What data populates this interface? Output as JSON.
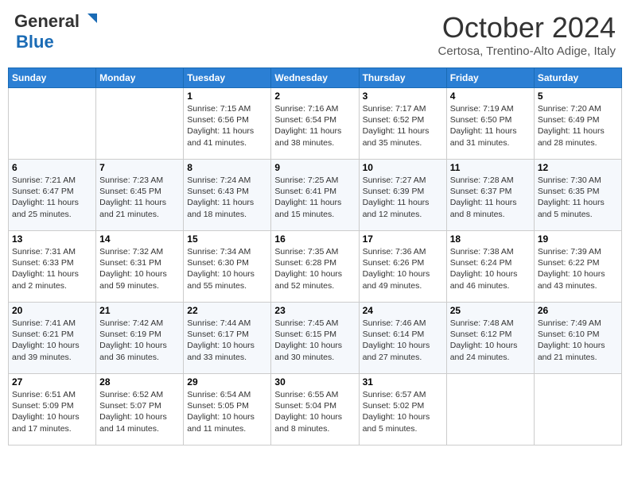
{
  "header": {
    "logo_main": "General",
    "logo_sub": "Blue",
    "month": "October 2024",
    "location": "Certosa, Trentino-Alto Adige, Italy"
  },
  "days_of_week": [
    "Sunday",
    "Monday",
    "Tuesday",
    "Wednesday",
    "Thursday",
    "Friday",
    "Saturday"
  ],
  "weeks": [
    [
      {
        "day": "",
        "sunrise": "",
        "sunset": "",
        "daylight": ""
      },
      {
        "day": "",
        "sunrise": "",
        "sunset": "",
        "daylight": ""
      },
      {
        "day": "1",
        "sunrise": "Sunrise: 7:15 AM",
        "sunset": "Sunset: 6:56 PM",
        "daylight": "Daylight: 11 hours and 41 minutes."
      },
      {
        "day": "2",
        "sunrise": "Sunrise: 7:16 AM",
        "sunset": "Sunset: 6:54 PM",
        "daylight": "Daylight: 11 hours and 38 minutes."
      },
      {
        "day": "3",
        "sunrise": "Sunrise: 7:17 AM",
        "sunset": "Sunset: 6:52 PM",
        "daylight": "Daylight: 11 hours and 35 minutes."
      },
      {
        "day": "4",
        "sunrise": "Sunrise: 7:19 AM",
        "sunset": "Sunset: 6:50 PM",
        "daylight": "Daylight: 11 hours and 31 minutes."
      },
      {
        "day": "5",
        "sunrise": "Sunrise: 7:20 AM",
        "sunset": "Sunset: 6:49 PM",
        "daylight": "Daylight: 11 hours and 28 minutes."
      }
    ],
    [
      {
        "day": "6",
        "sunrise": "Sunrise: 7:21 AM",
        "sunset": "Sunset: 6:47 PM",
        "daylight": "Daylight: 11 hours and 25 minutes."
      },
      {
        "day": "7",
        "sunrise": "Sunrise: 7:23 AM",
        "sunset": "Sunset: 6:45 PM",
        "daylight": "Daylight: 11 hours and 21 minutes."
      },
      {
        "day": "8",
        "sunrise": "Sunrise: 7:24 AM",
        "sunset": "Sunset: 6:43 PM",
        "daylight": "Daylight: 11 hours and 18 minutes."
      },
      {
        "day": "9",
        "sunrise": "Sunrise: 7:25 AM",
        "sunset": "Sunset: 6:41 PM",
        "daylight": "Daylight: 11 hours and 15 minutes."
      },
      {
        "day": "10",
        "sunrise": "Sunrise: 7:27 AM",
        "sunset": "Sunset: 6:39 PM",
        "daylight": "Daylight: 11 hours and 12 minutes."
      },
      {
        "day": "11",
        "sunrise": "Sunrise: 7:28 AM",
        "sunset": "Sunset: 6:37 PM",
        "daylight": "Daylight: 11 hours and 8 minutes."
      },
      {
        "day": "12",
        "sunrise": "Sunrise: 7:30 AM",
        "sunset": "Sunset: 6:35 PM",
        "daylight": "Daylight: 11 hours and 5 minutes."
      }
    ],
    [
      {
        "day": "13",
        "sunrise": "Sunrise: 7:31 AM",
        "sunset": "Sunset: 6:33 PM",
        "daylight": "Daylight: 11 hours and 2 minutes."
      },
      {
        "day": "14",
        "sunrise": "Sunrise: 7:32 AM",
        "sunset": "Sunset: 6:31 PM",
        "daylight": "Daylight: 10 hours and 59 minutes."
      },
      {
        "day": "15",
        "sunrise": "Sunrise: 7:34 AM",
        "sunset": "Sunset: 6:30 PM",
        "daylight": "Daylight: 10 hours and 55 minutes."
      },
      {
        "day": "16",
        "sunrise": "Sunrise: 7:35 AM",
        "sunset": "Sunset: 6:28 PM",
        "daylight": "Daylight: 10 hours and 52 minutes."
      },
      {
        "day": "17",
        "sunrise": "Sunrise: 7:36 AM",
        "sunset": "Sunset: 6:26 PM",
        "daylight": "Daylight: 10 hours and 49 minutes."
      },
      {
        "day": "18",
        "sunrise": "Sunrise: 7:38 AM",
        "sunset": "Sunset: 6:24 PM",
        "daylight": "Daylight: 10 hours and 46 minutes."
      },
      {
        "day": "19",
        "sunrise": "Sunrise: 7:39 AM",
        "sunset": "Sunset: 6:22 PM",
        "daylight": "Daylight: 10 hours and 43 minutes."
      }
    ],
    [
      {
        "day": "20",
        "sunrise": "Sunrise: 7:41 AM",
        "sunset": "Sunset: 6:21 PM",
        "daylight": "Daylight: 10 hours and 39 minutes."
      },
      {
        "day": "21",
        "sunrise": "Sunrise: 7:42 AM",
        "sunset": "Sunset: 6:19 PM",
        "daylight": "Daylight: 10 hours and 36 minutes."
      },
      {
        "day": "22",
        "sunrise": "Sunrise: 7:44 AM",
        "sunset": "Sunset: 6:17 PM",
        "daylight": "Daylight: 10 hours and 33 minutes."
      },
      {
        "day": "23",
        "sunrise": "Sunrise: 7:45 AM",
        "sunset": "Sunset: 6:15 PM",
        "daylight": "Daylight: 10 hours and 30 minutes."
      },
      {
        "day": "24",
        "sunrise": "Sunrise: 7:46 AM",
        "sunset": "Sunset: 6:14 PM",
        "daylight": "Daylight: 10 hours and 27 minutes."
      },
      {
        "day": "25",
        "sunrise": "Sunrise: 7:48 AM",
        "sunset": "Sunset: 6:12 PM",
        "daylight": "Daylight: 10 hours and 24 minutes."
      },
      {
        "day": "26",
        "sunrise": "Sunrise: 7:49 AM",
        "sunset": "Sunset: 6:10 PM",
        "daylight": "Daylight: 10 hours and 21 minutes."
      }
    ],
    [
      {
        "day": "27",
        "sunrise": "Sunrise: 6:51 AM",
        "sunset": "Sunset: 5:09 PM",
        "daylight": "Daylight: 10 hours and 17 minutes."
      },
      {
        "day": "28",
        "sunrise": "Sunrise: 6:52 AM",
        "sunset": "Sunset: 5:07 PM",
        "daylight": "Daylight: 10 hours and 14 minutes."
      },
      {
        "day": "29",
        "sunrise": "Sunrise: 6:54 AM",
        "sunset": "Sunset: 5:05 PM",
        "daylight": "Daylight: 10 hours and 11 minutes."
      },
      {
        "day": "30",
        "sunrise": "Sunrise: 6:55 AM",
        "sunset": "Sunset: 5:04 PM",
        "daylight": "Daylight: 10 hours and 8 minutes."
      },
      {
        "day": "31",
        "sunrise": "Sunrise: 6:57 AM",
        "sunset": "Sunset: 5:02 PM",
        "daylight": "Daylight: 10 hours and 5 minutes."
      },
      {
        "day": "",
        "sunrise": "",
        "sunset": "",
        "daylight": ""
      },
      {
        "day": "",
        "sunrise": "",
        "sunset": "",
        "daylight": ""
      }
    ]
  ]
}
